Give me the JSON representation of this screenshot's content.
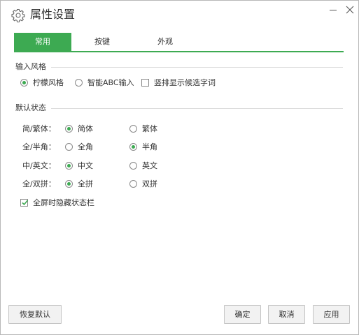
{
  "window": {
    "title": "属性设置"
  },
  "tabs": [
    {
      "label": "常用",
      "active": true
    },
    {
      "label": "按键",
      "active": false
    },
    {
      "label": "外观",
      "active": false
    }
  ],
  "input_style": {
    "section_title": "输入风格",
    "options": [
      {
        "label": "柠檬风格",
        "checked": true
      },
      {
        "label": "智能ABC输入",
        "checked": false
      }
    ],
    "vertical_candidates": {
      "label": "竖排显示候选字词",
      "checked": false
    }
  },
  "default_state": {
    "section_title": "默认状态",
    "rows": [
      {
        "label": "简/繁体：",
        "options": [
          {
            "label": "简体",
            "checked": true
          },
          {
            "label": "繁体",
            "checked": false
          }
        ]
      },
      {
        "label": "全/半角：",
        "options": [
          {
            "label": "全角",
            "checked": false
          },
          {
            "label": "半角",
            "checked": true
          }
        ]
      },
      {
        "label": "中/英文：",
        "options": [
          {
            "label": "中文",
            "checked": true
          },
          {
            "label": "英文",
            "checked": false
          }
        ]
      },
      {
        "label": "全/双拼：",
        "options": [
          {
            "label": "全拼",
            "checked": true
          },
          {
            "label": "双拼",
            "checked": false
          }
        ]
      }
    ],
    "hide_statusbar": {
      "label": "全屏时隐藏状态栏",
      "checked": true
    }
  },
  "buttons": {
    "restore_default": "恢复默认",
    "ok": "确定",
    "cancel": "取消",
    "apply": "应用"
  },
  "colors": {
    "accent": "#3daa52"
  }
}
